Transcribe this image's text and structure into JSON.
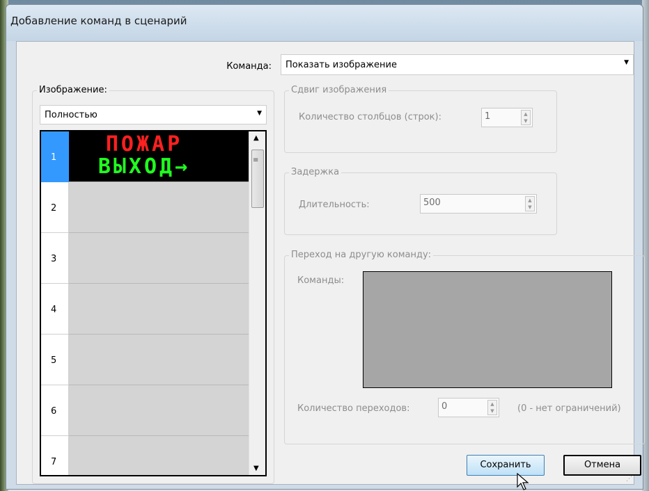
{
  "window": {
    "title": "Добавление команд в сценарий"
  },
  "command": {
    "label": "Команда:",
    "value": "Показать изображение"
  },
  "image": {
    "label": "Изображение:",
    "mode": "Полностью",
    "rows": [
      {
        "num": "1",
        "line1": "ПОЖАР",
        "line2": "ВЫХОД→"
      },
      {
        "num": "2"
      },
      {
        "num": "3"
      },
      {
        "num": "4"
      },
      {
        "num": "5"
      },
      {
        "num": "6"
      },
      {
        "num": "7"
      }
    ]
  },
  "shift": {
    "title": "Сдвиг изображения",
    "label": "Количество столбцов (строк):",
    "value": "1"
  },
  "delay": {
    "title": "Задержка",
    "label": "Длительность:",
    "value": "500"
  },
  "jump": {
    "title": "Переход на другую команду:",
    "commands_label": "Команды:",
    "count_label": "Количество переходов:",
    "count_value": "0",
    "hint": "(0 - нет ограничений)"
  },
  "buttons": {
    "save": "Сохранить",
    "cancel": "Отмена"
  },
  "colors": {
    "selection": "#3399ff",
    "led_red": "#ff2020",
    "led_green": "#20ff20"
  }
}
